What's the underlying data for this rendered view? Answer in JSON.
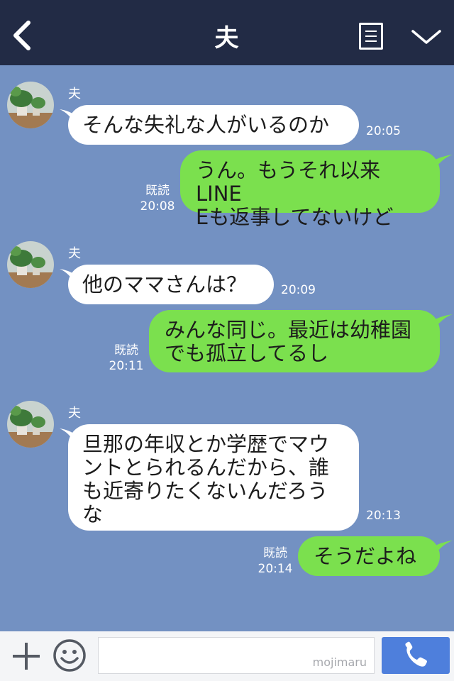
{
  "header": {
    "title": "夫",
    "back_icon": "chevron-left-icon",
    "notes_icon": "notes-icon",
    "menu_icon": "chevron-down-icon"
  },
  "messages": [
    {
      "side": "in",
      "sender": "夫",
      "text": "そんな失礼な人がいるのか",
      "time": "20:05"
    },
    {
      "side": "out",
      "read": "既読",
      "text": "うん。もうそれ以来LINE\nEも返事してないけど",
      "time": "20:08"
    },
    {
      "side": "in",
      "sender": "夫",
      "text": "他のママさんは？",
      "time": "20:09"
    },
    {
      "side": "out",
      "read": "既読",
      "text": "みんな同じ。最近は幼稚園\nでも孤立してるし",
      "time": "20:11"
    },
    {
      "side": "in",
      "sender": "夫",
      "text": "旦那の年収とか学歴でマウ\nントとられるんだから、誰\nも近寄りたくないんだろう\nな",
      "time": "20:13"
    },
    {
      "side": "out",
      "read": "既読",
      "text": "そうだよね",
      "time": "20:14"
    }
  ],
  "input": {
    "value": "",
    "watermark": "mojimaru",
    "plus_icon": "plus-icon",
    "emoji_icon": "smiley-icon",
    "call_icon": "phone-icon"
  },
  "colors": {
    "header_bg": "#222b45",
    "chat_bg": "#7391c2",
    "outgoing_bubble": "#7be04e",
    "incoming_bubble": "#ffffff",
    "call_button": "#4e7fdc"
  }
}
